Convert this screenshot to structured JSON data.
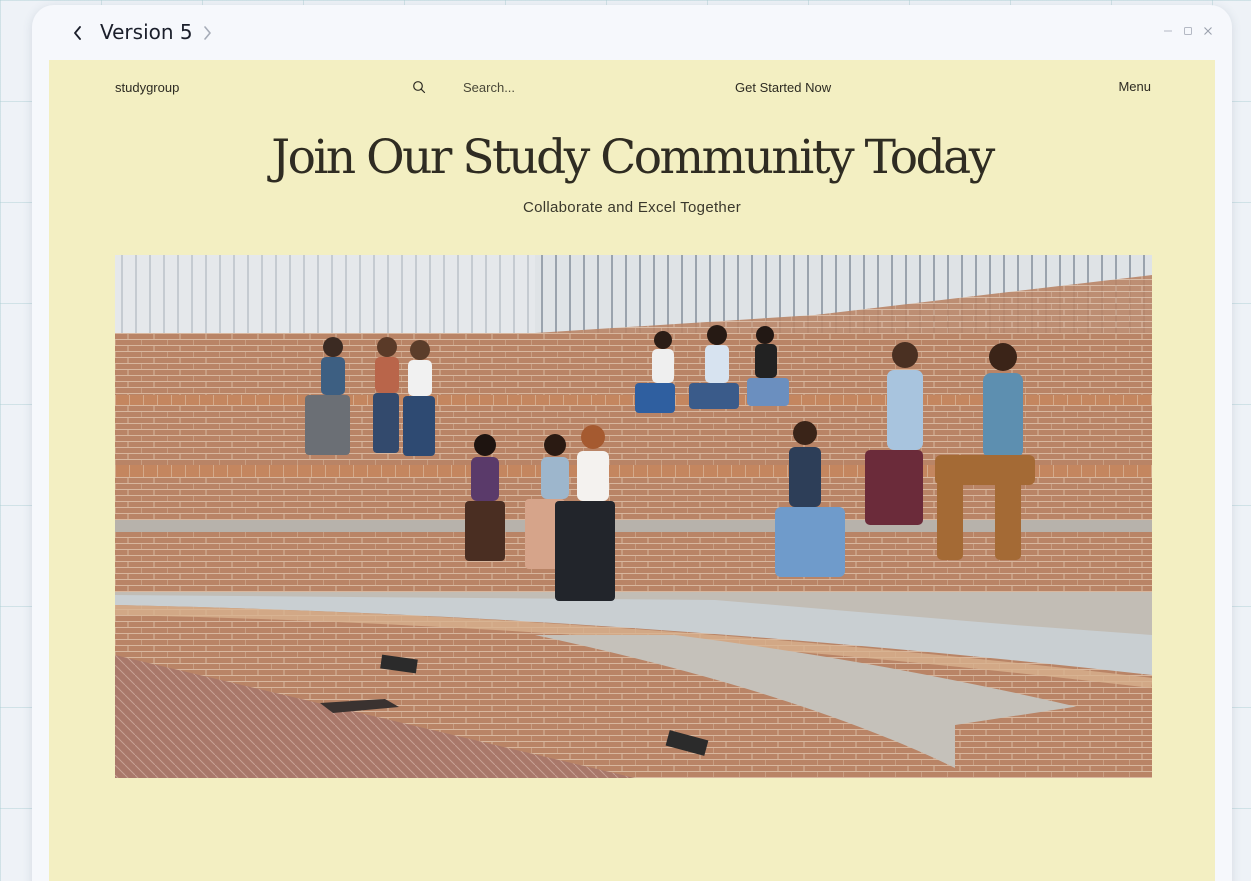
{
  "window": {
    "title": "Version 5",
    "back_icon": "chevron-left-icon",
    "forward_icon": "chevron-right-icon"
  },
  "site": {
    "brand": "studygroup",
    "search": {
      "placeholder": "Search...",
      "icon": "search-icon"
    },
    "cta": "Get Started Now",
    "menu": "Menu"
  },
  "hero": {
    "title": "Join Our Study Community Today",
    "subtitle": "Collaborate and Excel Together",
    "image_alt": "students studying on brick amphitheater steps"
  },
  "colors": {
    "page_bg": "#f3efc2",
    "text": "#2f2c22",
    "window_bg": "#f6f8fc"
  }
}
